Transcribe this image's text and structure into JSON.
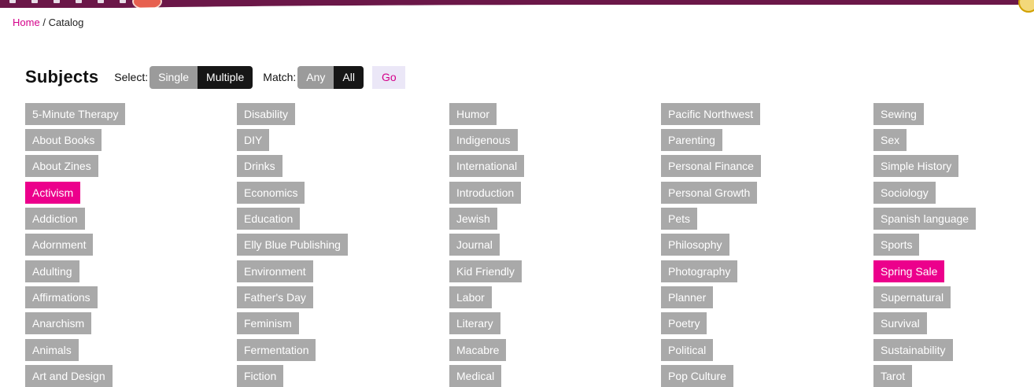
{
  "breadcrumb": {
    "home": "Home",
    "separator": "/",
    "current": "Catalog"
  },
  "subjects": {
    "title": "Subjects",
    "select_label": "Select:",
    "select_options": [
      {
        "label": "Single",
        "active": false
      },
      {
        "label": "Multiple",
        "active": true
      }
    ],
    "match_label": "Match:",
    "match_options": [
      {
        "label": "Any",
        "active": false
      },
      {
        "label": "All",
        "active": true
      }
    ],
    "go_label": "Go"
  },
  "colors": {
    "accent": "#ec008c",
    "tag": "#a9a9a9",
    "top_band": "#6b1748",
    "link": "#d4008a"
  },
  "columns": [
    [
      {
        "label": "5-Minute Therapy",
        "selected": false
      },
      {
        "label": "About Books",
        "selected": false
      },
      {
        "label": "About Zines",
        "selected": false
      },
      {
        "label": "Activism",
        "selected": true
      },
      {
        "label": "Addiction",
        "selected": false
      },
      {
        "label": "Adornment",
        "selected": false
      },
      {
        "label": "Adulting",
        "selected": false
      },
      {
        "label": "Affirmations",
        "selected": false
      },
      {
        "label": "Anarchism",
        "selected": false
      },
      {
        "label": "Animals",
        "selected": false
      },
      {
        "label": "Art and Design",
        "selected": false
      }
    ],
    [
      {
        "label": "Disability",
        "selected": false
      },
      {
        "label": "DIY",
        "selected": false
      },
      {
        "label": "Drinks",
        "selected": false
      },
      {
        "label": "Economics",
        "selected": false
      },
      {
        "label": "Education",
        "selected": false
      },
      {
        "label": "Elly Blue Publishing",
        "selected": false
      },
      {
        "label": "Environment",
        "selected": false
      },
      {
        "label": "Father's Day",
        "selected": false
      },
      {
        "label": "Feminism",
        "selected": false
      },
      {
        "label": "Fermentation",
        "selected": false
      },
      {
        "label": "Fiction",
        "selected": false
      }
    ],
    [
      {
        "label": "Humor",
        "selected": false
      },
      {
        "label": "Indigenous",
        "selected": false
      },
      {
        "label": "International",
        "selected": false
      },
      {
        "label": "Introduction",
        "selected": false
      },
      {
        "label": "Jewish",
        "selected": false
      },
      {
        "label": "Journal",
        "selected": false
      },
      {
        "label": "Kid Friendly",
        "selected": false
      },
      {
        "label": "Labor",
        "selected": false
      },
      {
        "label": "Literary",
        "selected": false
      },
      {
        "label": "Macabre",
        "selected": false
      },
      {
        "label": "Medical",
        "selected": false
      }
    ],
    [
      {
        "label": "Pacific Northwest",
        "selected": false
      },
      {
        "label": "Parenting",
        "selected": false
      },
      {
        "label": "Personal Finance",
        "selected": false
      },
      {
        "label": "Personal Growth",
        "selected": false
      },
      {
        "label": "Pets",
        "selected": false
      },
      {
        "label": "Philosophy",
        "selected": false
      },
      {
        "label": "Photography",
        "selected": false
      },
      {
        "label": "Planner",
        "selected": false
      },
      {
        "label": "Poetry",
        "selected": false
      },
      {
        "label": "Political",
        "selected": false
      },
      {
        "label": "Pop Culture",
        "selected": false
      }
    ],
    [
      {
        "label": "Sewing",
        "selected": false
      },
      {
        "label": "Sex",
        "selected": false
      },
      {
        "label": "Simple History",
        "selected": false
      },
      {
        "label": "Sociology",
        "selected": false
      },
      {
        "label": "Spanish language",
        "selected": false
      },
      {
        "label": "Sports",
        "selected": false
      },
      {
        "label": "Spring Sale",
        "selected": true
      },
      {
        "label": "Supernatural",
        "selected": false
      },
      {
        "label": "Survival",
        "selected": false
      },
      {
        "label": "Sustainability",
        "selected": false
      },
      {
        "label": "Tarot",
        "selected": false
      }
    ]
  ]
}
